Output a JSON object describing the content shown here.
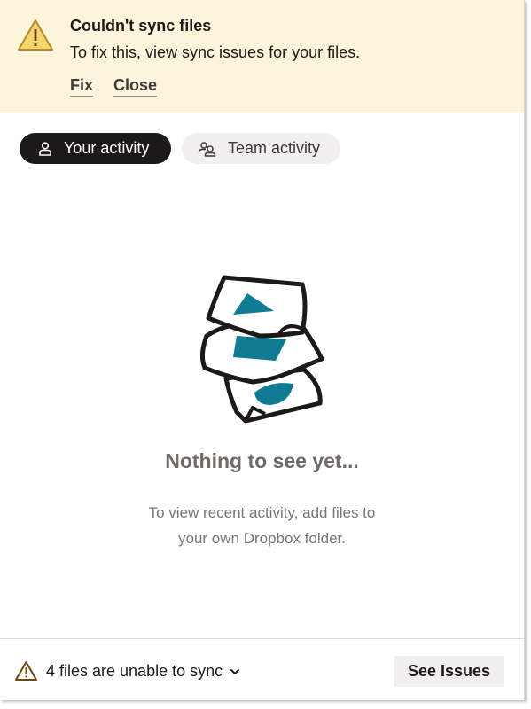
{
  "banner": {
    "icon": "warning-triangle-icon",
    "title": "Couldn't sync files",
    "message": "To fix this, view sync issues for your files.",
    "fix_label": "Fix",
    "close_label": "Close",
    "background": "#fdf4dc"
  },
  "tabs": [
    {
      "label": "Your activity",
      "icon": "person-icon",
      "active": true
    },
    {
      "label": "Team activity",
      "icon": "people-icon",
      "active": false
    }
  ],
  "empty_state": {
    "illustration": "stacked-files-illustration",
    "title": "Nothing to see yet...",
    "description_line1": "To view recent activity, add files to",
    "description_line2": "your own Dropbox folder."
  },
  "footer": {
    "icon": "warning-triangle-icon",
    "status_text": "4 files are unable to sync",
    "dropdown_icon": "chevron-down-icon",
    "see_issues_label": "See Issues"
  },
  "colors": {
    "accent_teal": "#0f7c94",
    "dark": "#1e1919",
    "warning_yellow": "#f7d46e",
    "warning_brown": "#6b4a12"
  }
}
